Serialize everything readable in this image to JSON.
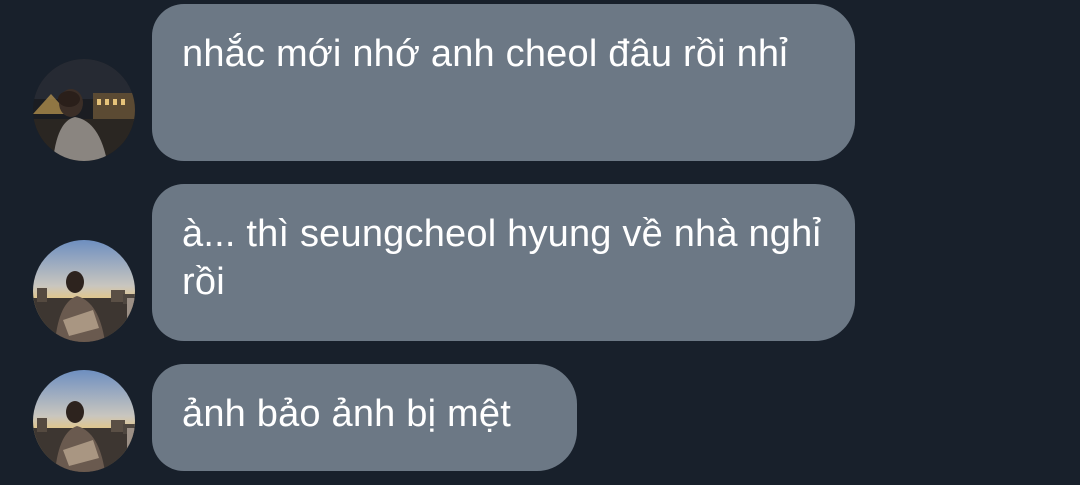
{
  "messages": [
    {
      "avatar": "night-city-avatar",
      "text": "nhắc mới nhớ anh cheol đâu rồi nhỉ"
    },
    {
      "avatar": "sunset-rooftop-avatar",
      "text": "à... thì seungcheol hyung về nhà nghỉ rồi"
    },
    {
      "avatar": "sunset-rooftop-avatar",
      "text": "ảnh bảo ảnh bị mệt"
    }
  ],
  "colors": {
    "background": "#18202b",
    "bubble": "#6c7885",
    "text": "#ffffff"
  }
}
